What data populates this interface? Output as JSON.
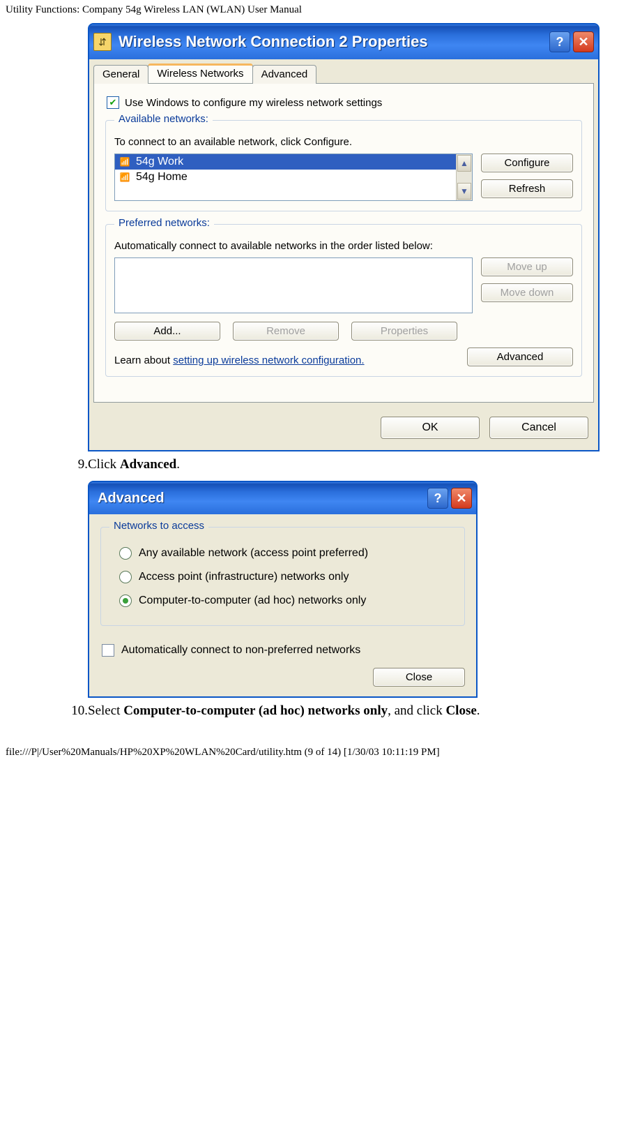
{
  "page": {
    "header": "Utility Functions: Company 54g Wireless LAN (WLAN) User Manual",
    "footer": "file:///P|/User%20Manuals/HP%20XP%20WLAN%20Card/utility.htm (9 of 14) [1/30/03 10:11:19 PM]"
  },
  "win1": {
    "title": "Wireless Network Connection 2 Properties",
    "help": "?",
    "close": "✕",
    "tabs": {
      "general": "General",
      "wireless": "Wireless Networks",
      "advanced": "Advanced"
    },
    "use_windows_label": "Use Windows to configure my wireless network settings",
    "available": {
      "legend": "Available networks:",
      "hint": "To connect to an available network, click Configure.",
      "items": [
        "54g Work",
        "54g Home"
      ],
      "configure": "Configure",
      "refresh": "Refresh"
    },
    "preferred": {
      "legend": "Preferred networks:",
      "hint": "Automatically connect to available networks in the order listed below:",
      "moveup": "Move up",
      "movedown": "Move down",
      "add": "Add...",
      "remove": "Remove",
      "properties": "Properties"
    },
    "learn_prefix": "Learn about ",
    "learn_link": "setting up wireless network configuration.",
    "advanced_btn": "Advanced",
    "ok": "OK",
    "cancel": "Cancel"
  },
  "step9": {
    "num": "9.  ",
    "pre": "Click ",
    "bold": "Advanced",
    "post": "."
  },
  "win2": {
    "title": "Advanced",
    "help": "?",
    "close": "✕",
    "group_legend": "Networks to access",
    "opt1": "Any available network (access point preferred)",
    "opt2": "Access point (infrastructure) networks only",
    "opt3": "Computer-to-computer (ad hoc) networks only",
    "auto_label": "Automatically connect to non-preferred networks",
    "close_btn": "Close"
  },
  "step10": {
    "num": "10.  ",
    "pre": "Select ",
    "bold1": "Computer-to-computer (ad hoc) networks only",
    "mid": ", and click ",
    "bold2": "Close",
    "post": "."
  }
}
